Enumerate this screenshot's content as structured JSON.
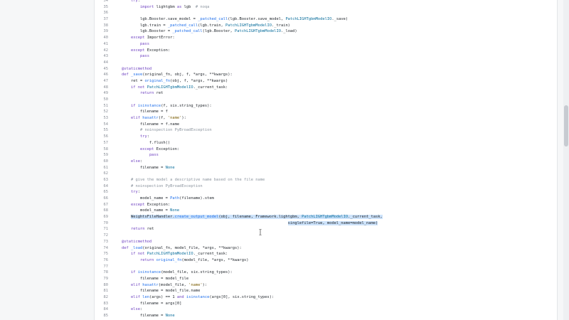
{
  "code": {
    "lines": [
      {
        "n": "34",
        "tokens": [
          {
            "t": "        "
          },
          {
            "t": "try",
            "c": "kw"
          },
          {
            "t": ":"
          }
        ]
      },
      {
        "n": "35",
        "tokens": [
          {
            "t": "            "
          },
          {
            "t": "import",
            "c": "kw"
          },
          {
            "t": " lightgbm "
          },
          {
            "t": "as",
            "c": "kw"
          },
          {
            "t": " lgb  "
          },
          {
            "t": "# noqa",
            "c": "cm"
          }
        ]
      },
      {
        "n": "36",
        "tokens": [
          {
            "t": ""
          }
        ]
      },
      {
        "n": "37",
        "tokens": [
          {
            "t": "            lgb.Booster.save_model = "
          },
          {
            "t": "_patched_call",
            "c": "fn"
          },
          {
            "t": "(lgb.Booster.save_model, "
          },
          {
            "t": "PatchLIGHTgbmModelIO",
            "c": "cls"
          },
          {
            "t": "._save)"
          }
        ]
      },
      {
        "n": "38",
        "tokens": [
          {
            "t": "            lgb.train = "
          },
          {
            "t": "_patched_call",
            "c": "fn"
          },
          {
            "t": "(lgb.train, "
          },
          {
            "t": "PatchLIGHTgbmModelIO",
            "c": "cls"
          },
          {
            "t": "._train)"
          }
        ]
      },
      {
        "n": "39",
        "tokens": [
          {
            "t": "            lgb.Booster = "
          },
          {
            "t": "_patched_call",
            "c": "fn"
          },
          {
            "t": "(lgb.Booster, "
          },
          {
            "t": "PatchLIGHTgbmModelIO",
            "c": "cls"
          },
          {
            "t": "._load)"
          }
        ]
      },
      {
        "n": "40",
        "tokens": [
          {
            "t": "        "
          },
          {
            "t": "except",
            "c": "kw"
          },
          {
            "t": " ImportError:"
          }
        ]
      },
      {
        "n": "41",
        "tokens": [
          {
            "t": "            "
          },
          {
            "t": "pass",
            "c": "kw"
          }
        ]
      },
      {
        "n": "42",
        "tokens": [
          {
            "t": "        "
          },
          {
            "t": "except",
            "c": "kw"
          },
          {
            "t": " Exception:"
          }
        ]
      },
      {
        "n": "43",
        "tokens": [
          {
            "t": "            "
          },
          {
            "t": "pass",
            "c": "kw"
          }
        ]
      },
      {
        "n": "44",
        "tokens": [
          {
            "t": ""
          }
        ]
      },
      {
        "n": "45",
        "tokens": [
          {
            "t": "    "
          },
          {
            "t": "@staticmethod",
            "c": "dec"
          }
        ]
      },
      {
        "n": "46",
        "tokens": [
          {
            "t": "    "
          },
          {
            "t": "def",
            "c": "kw"
          },
          {
            "t": " "
          },
          {
            "t": "_save",
            "c": "fn"
          },
          {
            "t": "(original_fn, obj, f, *args, **kwargs):"
          }
        ]
      },
      {
        "n": "47",
        "tokens": [
          {
            "t": "        ret = "
          },
          {
            "t": "original_fn",
            "c": "fn"
          },
          {
            "t": "(obj, f, *args, **kwargs)"
          }
        ]
      },
      {
        "n": "48",
        "tokens": [
          {
            "t": "        "
          },
          {
            "t": "if not",
            "c": "kw"
          },
          {
            "t": " "
          },
          {
            "t": "PatchLIGHTgbmModelIO",
            "c": "cls"
          },
          {
            "t": "._current_task:"
          }
        ]
      },
      {
        "n": "49",
        "tokens": [
          {
            "t": "            "
          },
          {
            "t": "return",
            "c": "kw"
          },
          {
            "t": " ret"
          }
        ]
      },
      {
        "n": "50",
        "tokens": [
          {
            "t": ""
          }
        ]
      },
      {
        "n": "51",
        "tokens": [
          {
            "t": "        "
          },
          {
            "t": "if",
            "c": "kw"
          },
          {
            "t": " "
          },
          {
            "t": "isinstance",
            "c": "fn"
          },
          {
            "t": "(f, six.string_types):"
          }
        ]
      },
      {
        "n": "52",
        "tokens": [
          {
            "t": "            filename = f"
          }
        ]
      },
      {
        "n": "53",
        "tokens": [
          {
            "t": "        "
          },
          {
            "t": "elif",
            "c": "kw"
          },
          {
            "t": " "
          },
          {
            "t": "hasattr",
            "c": "fn"
          },
          {
            "t": "(f, "
          },
          {
            "t": "'name'",
            "c": "str"
          },
          {
            "t": "):"
          }
        ]
      },
      {
        "n": "54",
        "tokens": [
          {
            "t": "            filename = f.name"
          }
        ]
      },
      {
        "n": "55",
        "tokens": [
          {
            "t": "            "
          },
          {
            "t": "# noinspection PyBroadException",
            "c": "cm"
          }
        ]
      },
      {
        "n": "56",
        "tokens": [
          {
            "t": "            "
          },
          {
            "t": "try",
            "c": "kw"
          },
          {
            "t": ":"
          }
        ]
      },
      {
        "n": "57",
        "tokens": [
          {
            "t": "                f.flush()"
          }
        ]
      },
      {
        "n": "58",
        "tokens": [
          {
            "t": "            "
          },
          {
            "t": "except",
            "c": "kw"
          },
          {
            "t": " Exception:"
          }
        ]
      },
      {
        "n": "59",
        "tokens": [
          {
            "t": "                "
          },
          {
            "t": "pass",
            "c": "kw"
          }
        ]
      },
      {
        "n": "60",
        "tokens": [
          {
            "t": "        "
          },
          {
            "t": "else",
            "c": "kw"
          },
          {
            "t": ":"
          }
        ]
      },
      {
        "n": "61",
        "tokens": [
          {
            "t": "            filename = "
          },
          {
            "t": "None",
            "c": "cls"
          }
        ]
      },
      {
        "n": "62",
        "tokens": [
          {
            "t": ""
          }
        ]
      },
      {
        "n": "63",
        "tokens": [
          {
            "t": "        "
          },
          {
            "t": "# give the model a descriptive name based on the file name",
            "c": "cm"
          }
        ]
      },
      {
        "n": "64",
        "tokens": [
          {
            "t": "        "
          },
          {
            "t": "# noinspection PyBroadException",
            "c": "cm"
          }
        ]
      },
      {
        "n": "65",
        "tokens": [
          {
            "t": "        "
          },
          {
            "t": "try",
            "c": "kw"
          },
          {
            "t": ":"
          }
        ]
      },
      {
        "n": "66",
        "tokens": [
          {
            "t": "            model_name = "
          },
          {
            "t": "Path",
            "c": "fn"
          },
          {
            "t": "(filename).stem"
          }
        ]
      },
      {
        "n": "67",
        "tokens": [
          {
            "t": "        "
          },
          {
            "t": "except",
            "c": "kw"
          },
          {
            "t": " Exception:"
          }
        ]
      },
      {
        "n": "68",
        "tokens": [
          {
            "t": "            model_name = "
          },
          {
            "t": "None",
            "c": "cls"
          }
        ]
      },
      {
        "n": "69",
        "sel": true,
        "tokens": [
          {
            "t": "        "
          },
          {
            "t": "WeightsFileHandler.",
            "s": 1
          },
          {
            "t": "create_output_model",
            "c": "fn",
            "s": 1
          },
          {
            "t": "(obj, filename, Framework.lightgbm, ",
            "s": 1
          },
          {
            "t": "PatchLIGHTgbmModelIO",
            "c": "cls",
            "s": 1
          },
          {
            "t": "._current_task,",
            "s": 1
          }
        ]
      },
      {
        "n": "70",
        "sel": true,
        "tokens": [
          {
            "t": "                                                                            "
          },
          {
            "t": "singlefile=True, model_name=model_name)",
            "s": 1
          }
        ]
      },
      {
        "n": "71",
        "tokens": [
          {
            "t": "        "
          },
          {
            "t": "return",
            "c": "kw"
          },
          {
            "t": " ret"
          }
        ]
      },
      {
        "n": "72",
        "tokens": [
          {
            "t": ""
          }
        ]
      },
      {
        "n": "73",
        "tokens": [
          {
            "t": "    "
          },
          {
            "t": "@staticmethod",
            "c": "dec"
          }
        ]
      },
      {
        "n": "74",
        "tokens": [
          {
            "t": "    "
          },
          {
            "t": "def",
            "c": "kw"
          },
          {
            "t": " "
          },
          {
            "t": "_load",
            "c": "fn"
          },
          {
            "t": "(original_fn, model_file, *args, **kwargs):"
          }
        ]
      },
      {
        "n": "75",
        "tokens": [
          {
            "t": "        "
          },
          {
            "t": "if not",
            "c": "kw"
          },
          {
            "t": " "
          },
          {
            "t": "PatchLIGHTgbmModelIO",
            "c": "cls"
          },
          {
            "t": "._current_task:"
          }
        ]
      },
      {
        "n": "76",
        "tokens": [
          {
            "t": "            "
          },
          {
            "t": "return",
            "c": "kw"
          },
          {
            "t": " "
          },
          {
            "t": "original_fn",
            "c": "fn"
          },
          {
            "t": "(model_file, *args, **kwargs)"
          }
        ]
      },
      {
        "n": "77",
        "tokens": [
          {
            "t": ""
          }
        ]
      },
      {
        "n": "78",
        "tokens": [
          {
            "t": "        "
          },
          {
            "t": "if",
            "c": "kw"
          },
          {
            "t": " "
          },
          {
            "t": "isinstance",
            "c": "fn"
          },
          {
            "t": "(model_file, six.string_types):"
          }
        ]
      },
      {
        "n": "79",
        "tokens": [
          {
            "t": "            filename = model_file"
          }
        ]
      },
      {
        "n": "80",
        "tokens": [
          {
            "t": "        "
          },
          {
            "t": "elif",
            "c": "kw"
          },
          {
            "t": " "
          },
          {
            "t": "hasattr",
            "c": "fn"
          },
          {
            "t": "(model_file, "
          },
          {
            "t": "'name'",
            "c": "str"
          },
          {
            "t": "):"
          }
        ]
      },
      {
        "n": "81",
        "tokens": [
          {
            "t": "            filename = model_file.name"
          }
        ]
      },
      {
        "n": "82",
        "tokens": [
          {
            "t": "        "
          },
          {
            "t": "elif",
            "c": "kw"
          },
          {
            "t": " "
          },
          {
            "t": "len",
            "c": "fn"
          },
          {
            "t": "(args) == 1 "
          },
          {
            "t": "and",
            "c": "kw"
          },
          {
            "t": " "
          },
          {
            "t": "isinstance",
            "c": "fn"
          },
          {
            "t": "(args[0], six.string_types):"
          }
        ]
      },
      {
        "n": "83",
        "tokens": [
          {
            "t": "            filename = args[0]"
          }
        ]
      },
      {
        "n": "84",
        "tokens": [
          {
            "t": "        "
          },
          {
            "t": "else",
            "c": "kw"
          },
          {
            "t": ":"
          }
        ]
      },
      {
        "n": "85",
        "tokens": [
          {
            "t": "            filename = "
          },
          {
            "t": "None",
            "c": "cls"
          }
        ]
      }
    ]
  }
}
